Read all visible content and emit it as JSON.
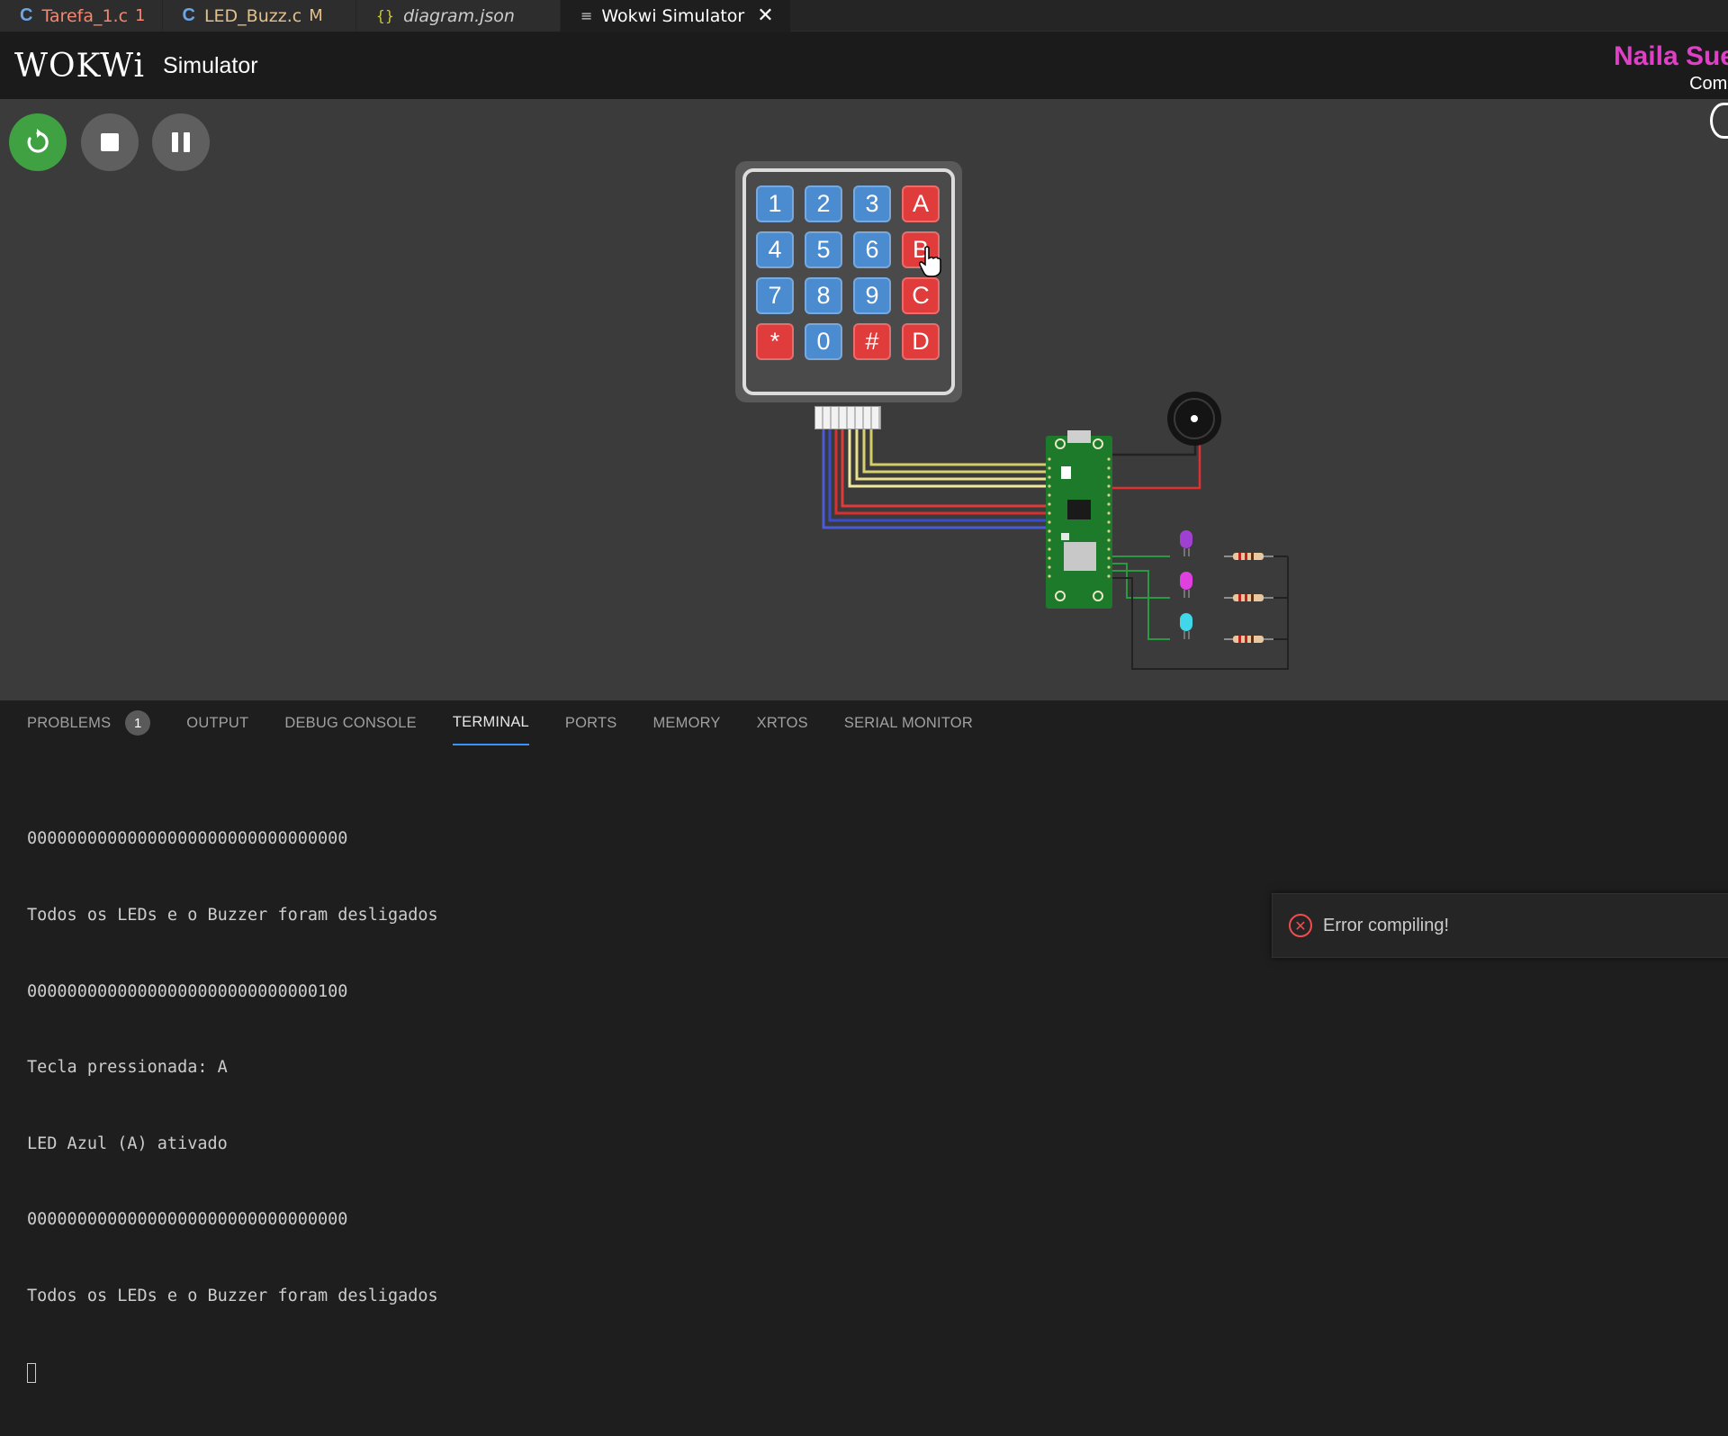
{
  "tabs": [
    {
      "icon": "C",
      "name": "Tarefa_1.c",
      "status": "1",
      "active": false
    },
    {
      "icon": "C",
      "name": "LED_Buzz.c",
      "status": "M",
      "active": false
    },
    {
      "icon": "{}",
      "name": "diagram.json",
      "status": "",
      "active": false
    },
    {
      "icon": "≡",
      "name": "Wokwi Simulator",
      "status": "",
      "active": true
    }
  ],
  "header": {
    "logo": "WOKWi",
    "title": "Simulator",
    "user_name": "Naila Sue",
    "user_sub": "Comr"
  },
  "controls": {
    "restart_icon": "restart-icon",
    "stop_icon": "stop-icon",
    "pause_icon": "pause-icon"
  },
  "keypad": {
    "keys": [
      "1",
      "2",
      "3",
      "A",
      "4",
      "5",
      "6",
      "B",
      "7",
      "8",
      "9",
      "C",
      "*",
      "0",
      "#",
      "D"
    ]
  },
  "panel": {
    "tabs": [
      "PROBLEMS",
      "OUTPUT",
      "DEBUG CONSOLE",
      "TERMINAL",
      "PORTS",
      "MEMORY",
      "XRTOS",
      "SERIAL MONITOR"
    ],
    "active_tab": "TERMINAL",
    "problems_count": "1"
  },
  "terminal": {
    "lines": [
      "00000000000000000000000000000000",
      "Todos os LEDs e o Buzzer foram desligados",
      "00000000000000000000000000000100",
      "Tecla pressionada: A",
      "LED Azul (A) ativado",
      "00000000000000000000000000000000",
      "Todos os LEDs e o Buzzer foram desligados"
    ]
  },
  "toast": {
    "message": "Error compiling!"
  },
  "colors": {
    "run_green": "#3fa142",
    "key_blue": "#4b8bd0",
    "key_red": "#e03c3c",
    "user_magenta": "#e040c8",
    "error_red": "#f14c4c"
  }
}
